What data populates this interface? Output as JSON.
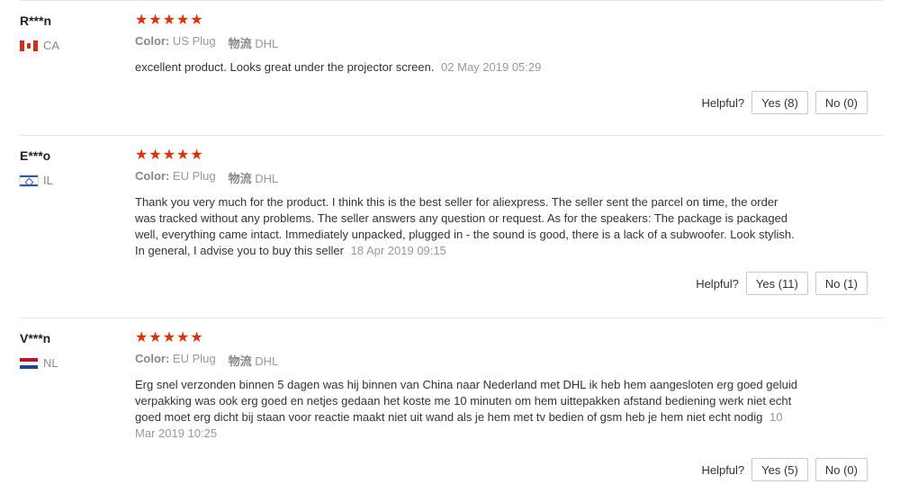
{
  "reviews": [
    {
      "user": "R***n",
      "country": "CA",
      "stars": "★★★★★",
      "color_label": "Color:",
      "color_value": "US Plug",
      "shipping_label": "物流",
      "shipping_value": "DHL",
      "text": "excellent product. Looks great under the projector screen.",
      "date": "02 May 2019 05:29",
      "helpful_label": "Helpful?",
      "yes_label": "Yes (8)",
      "no_label": "No (0)"
    },
    {
      "user": "E***o",
      "country": "IL",
      "stars": "★★★★★",
      "color_label": "Color:",
      "color_value": "EU Plug",
      "shipping_label": "物流",
      "shipping_value": "DHL",
      "text": "Thank you very much for the product. I think this is the best seller for aliexpress. The seller sent the parcel on time, the order was tracked without any problems. The seller answers any question or request. As for the speakers: The package is packaged well, everything came intact. Immediately unpacked, plugged in - the sound is good, there is a lack of a subwoofer. Look stylish. In general, I advise you to buy this seller",
      "date": "18 Apr 2019 09:15",
      "helpful_label": "Helpful?",
      "yes_label": "Yes (11)",
      "no_label": "No (1)"
    },
    {
      "user": "V***n",
      "country": "NL",
      "stars": "★★★★★",
      "color_label": "Color:",
      "color_value": "EU Plug",
      "shipping_label": "物流",
      "shipping_value": "DHL",
      "text": "Erg snel verzonden binnen 5 dagen was hij binnen van China naar Nederland met DHL ik heb hem aangesloten erg goed geluid verpakking was ook erg goed en netjes gedaan het koste me 10 minuten om hem uittepakken afstand bediening werk niet echt goed moet erg dicht bij staan voor reactie maakt niet uit wand als je hem met tv bedien of gsm heb je hem niet echt nodig",
      "date": "10 Mar 2019 10:25",
      "helpful_label": "Helpful?",
      "yes_label": "Yes (5)",
      "no_label": "No (0)"
    }
  ],
  "colors": {
    "star": "#e62e04",
    "border": "#e6e6e6",
    "muted": "#999999"
  }
}
